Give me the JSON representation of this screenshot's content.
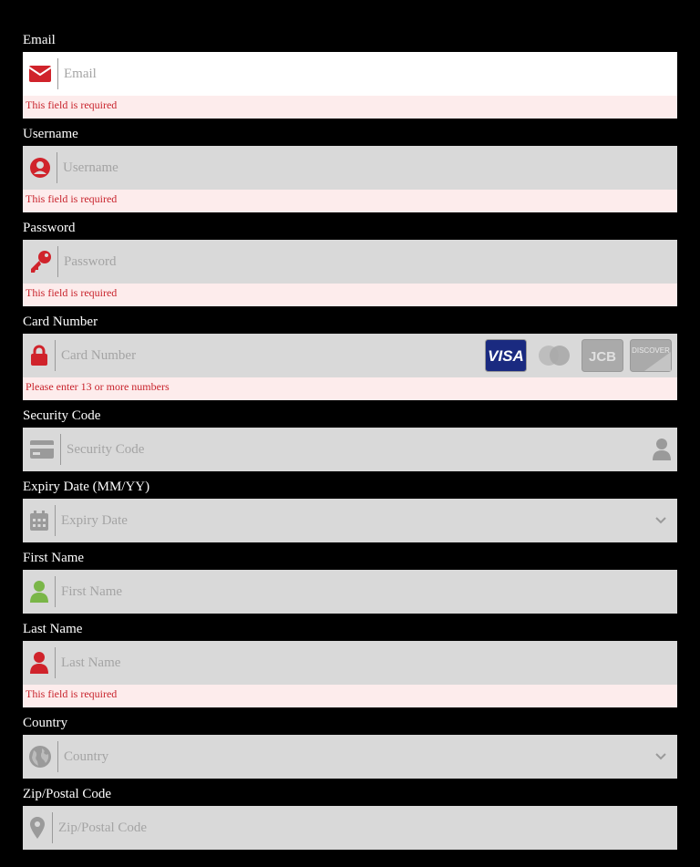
{
  "colors": {
    "background": "#000000",
    "field_bg": "#d9d9d9",
    "error_bg": "#fdecec",
    "error_text": "#c8232c",
    "icon_red": "#d0232b",
    "icon_grey": "#9a9a9a",
    "icon_green": "#7ab648"
  },
  "fields": {
    "email": {
      "label": "Email",
      "placeholder": "Email",
      "error": "This field is required",
      "icon": "envelope-icon"
    },
    "username": {
      "label": "Username",
      "placeholder": "Username",
      "error": "This field is required",
      "icon": "user-circle-icon"
    },
    "password": {
      "label": "Password",
      "placeholder": "Password",
      "error": "This field is required",
      "icon": "key-icon"
    },
    "card_number": {
      "label": "Card Number",
      "placeholder": "Card Number",
      "error": "Please enter 13 or more numbers",
      "icon": "lock-icon",
      "card_brands": [
        "VISA",
        "mastercard",
        "JCB",
        "DISCOVER"
      ]
    },
    "security_code": {
      "label": "Security Code",
      "placeholder": "Security Code",
      "icon": "credit-card-icon"
    },
    "expiry": {
      "label": "Expiry Date (MM/YY)",
      "placeholder": "Expiry Date",
      "icon": "calendar-icon"
    },
    "first_name": {
      "label": "First Name",
      "placeholder": "First Name",
      "icon": "user-icon"
    },
    "last_name": {
      "label": "Last Name",
      "placeholder": "Last Name",
      "error": "This field is required",
      "icon": "user-icon"
    },
    "country": {
      "label": "Country",
      "placeholder": "Country",
      "icon": "globe-icon"
    },
    "zip": {
      "label": "Zip/Postal Code",
      "placeholder": "Zip/Postal Code",
      "icon": "map-pin-icon"
    }
  }
}
